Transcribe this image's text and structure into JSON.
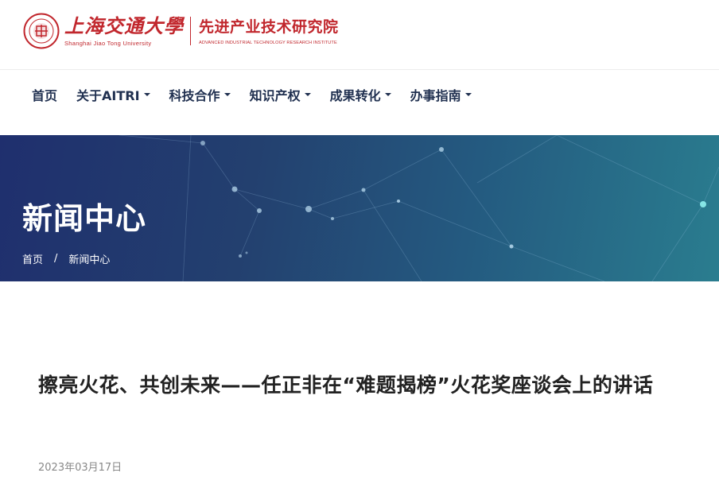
{
  "header": {
    "university_cn": "上海交通大學",
    "university_en": "Shanghai Jiao Tong University",
    "institute_cn": "先进产业技术研究院",
    "institute_en": "ADVANCED INDUSTRIAL TECHNOLOGY RESEARCH INSTITUTE",
    "brand_color": "#c1272d"
  },
  "nav": {
    "items": [
      {
        "label": "首页",
        "dropdown": false
      },
      {
        "label": "关于AITRI",
        "dropdown": true
      },
      {
        "label": "科技合作",
        "dropdown": true
      },
      {
        "label": "知识产权",
        "dropdown": true
      },
      {
        "label": "成果转化",
        "dropdown": true
      },
      {
        "label": "办事指南",
        "dropdown": true
      }
    ],
    "color": "#1f2f4f"
  },
  "banner": {
    "title": "新闻中心",
    "breadcrumb": {
      "home": "首页",
      "separator": "/",
      "current": "新闻中心"
    }
  },
  "article": {
    "title": "擦亮火花、共创未来——任正非在“难题揭榜”火花奖座谈会上的讲话",
    "date": "2023年03月17日"
  }
}
